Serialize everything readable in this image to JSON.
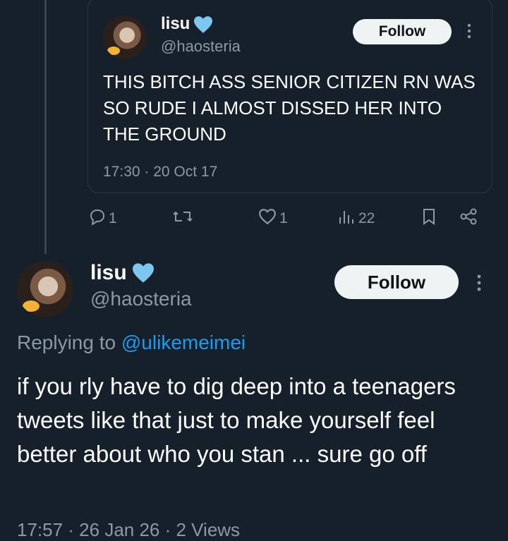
{
  "quoted": {
    "name": "lisu",
    "handle": "@haosteria",
    "follow_label": "Follow",
    "text": "THIS BITCH ASS SENIOR CITIZEN RN WAS SO RUDE I ALMOST DISSED HER INTO THE GROUND",
    "timestamp": "17:30 · 20 Oct 17"
  },
  "actions": {
    "replies": "1",
    "retweets": "",
    "likes": "1",
    "views": "22"
  },
  "main": {
    "name": "lisu",
    "handle": "@haosteria",
    "follow_label": "Follow",
    "replying_prefix": "Replying to ",
    "replying_mention": "@ulikemeimei",
    "text": "if you rly have to dig deep into a teenagers tweets like that just to make yourself feel better about who you stan ... sure go off",
    "meta": "17:57 · 26 Jan 26 · 2 Views"
  },
  "colors": {
    "background": "#15202b",
    "verified": "#7cc6f0",
    "link": "#1d9bf0",
    "muted": "#8b98a5"
  },
  "icons": [
    "verified-heart-icon",
    "more-icon",
    "reply-icon",
    "retweet-icon",
    "like-icon",
    "views-icon",
    "bookmark-icon",
    "share-icon"
  ]
}
